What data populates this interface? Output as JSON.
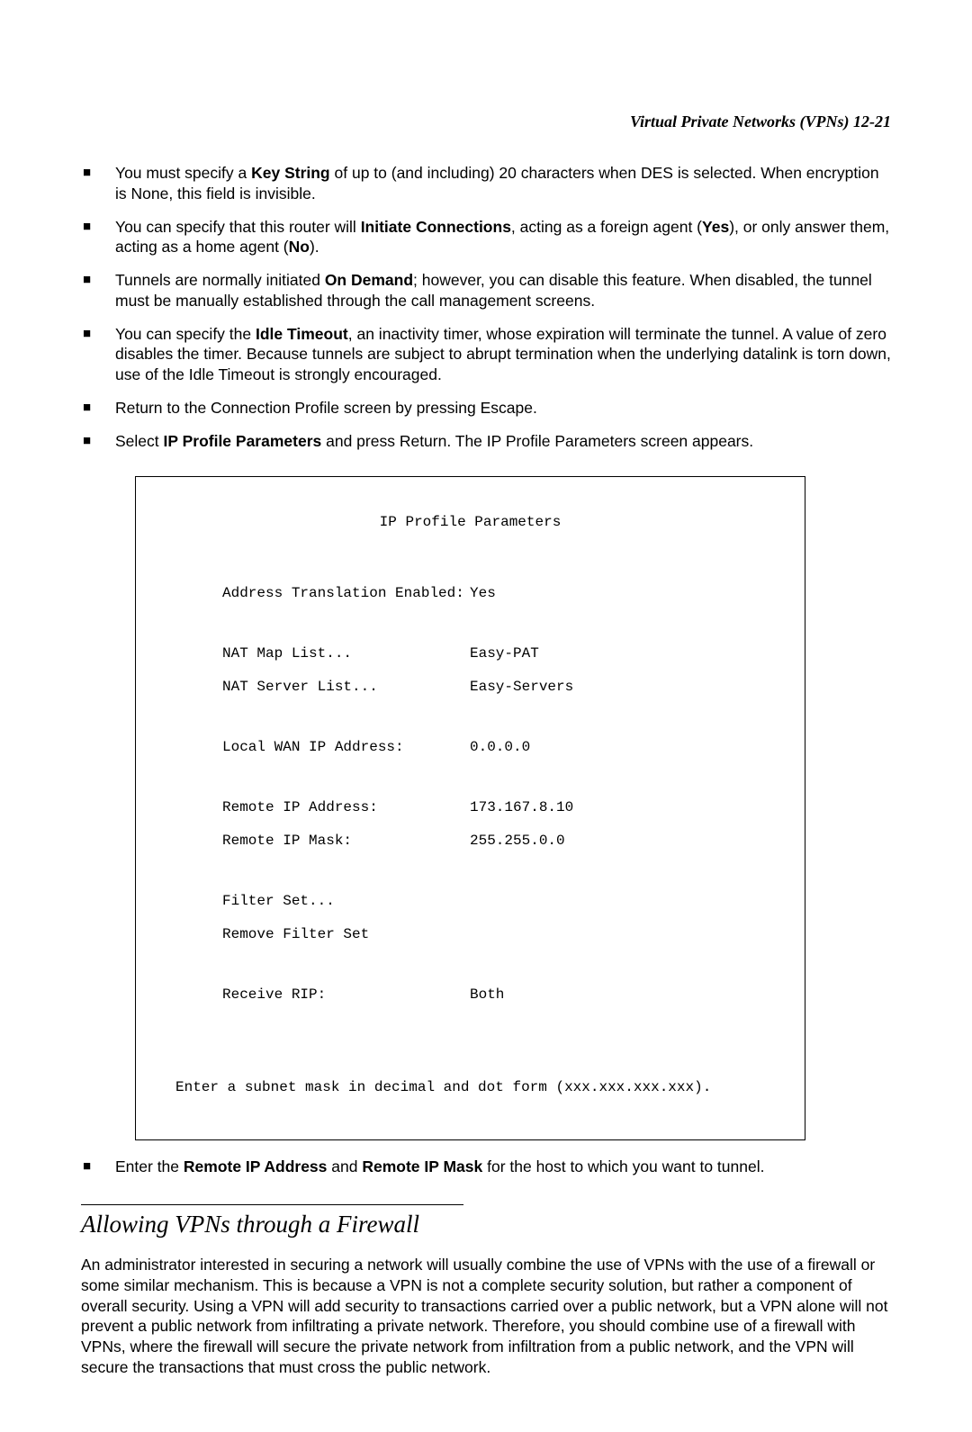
{
  "header": {
    "text": "Virtual Private Networks (VPNs)   12-21"
  },
  "bullets": [
    {
      "pre": "You must specify a ",
      "b1": "Key String",
      "post": " of up to (and including) 20 characters when DES is selected. When encryption is None, this field is invisible."
    },
    {
      "pre": "You can specify that this router will ",
      "b1": "Initiate Connections",
      "mid1": ", acting as a foreign agent (",
      "b2": "Yes",
      "mid2": "), or only answer them, acting as a home agent (",
      "b3": "No",
      "post": ")."
    },
    {
      "pre": "Tunnels are normally initiated ",
      "b1": "On Demand",
      "post": "; however, you can disable this feature. When disabled, the tunnel must be manually established through the call management screens."
    },
    {
      "pre": "You can specify the ",
      "b1": "Idle Timeout",
      "post": ", an inactivity timer, whose expiration will terminate the tunnel. A value of zero disables the timer. Because tunnels are subject to abrupt termination when the underlying datalink is torn down, use of the Idle Timeout is strongly encouraged."
    },
    {
      "pre": "Return to the Connection Profile screen by pressing Escape."
    },
    {
      "pre": "Select ",
      "b1": "IP Profile Parameters",
      "post": " and press Return. The IP Profile Parameters screen appears."
    }
  ],
  "terminal": {
    "title": "IP Profile Parameters",
    "rows": [
      {
        "label": "Address Translation Enabled:",
        "value": "Yes"
      },
      {
        "label": "NAT Map List...",
        "value": "Easy-PAT"
      },
      {
        "label": "NAT Server List...",
        "value": "Easy-Servers"
      },
      {
        "label": "Local WAN IP Address:",
        "value": "0.0.0.0"
      },
      {
        "label": "Remote IP Address:",
        "value": "173.167.8.10"
      },
      {
        "label": "Remote IP Mask:",
        "value": "255.255.0.0"
      },
      {
        "label": "Filter Set...",
        "value": ""
      },
      {
        "label": "Remove Filter Set",
        "value": ""
      },
      {
        "label": "Receive RIP:",
        "value": "Both"
      }
    ],
    "footer": "Enter a subnet mask in decimal and dot form (xxx.xxx.xxx.xxx)."
  },
  "post_bullet": {
    "pre": "Enter the ",
    "b1": "Remote IP Address",
    "mid": " and ",
    "b2": "Remote IP Mask",
    "post": " for the host to which you want to tunnel."
  },
  "section": {
    "heading": "Allowing VPNs through a Firewall"
  },
  "paragraph": "An administrator interested in securing a network will usually combine the use of VPNs with the use of a firewall or some similar mechanism. This is because a VPN is not a complete security solution, but rather a component of overall security. Using a VPN will add security to transactions carried over a public network, but a VPN alone will not prevent a public network from infiltrating a private network. Therefore, you should combine use of a firewall with VPNs, where the firewall will secure the private network from infiltration from a public network, and the VPN will secure the transactions that must cross the public network."
}
